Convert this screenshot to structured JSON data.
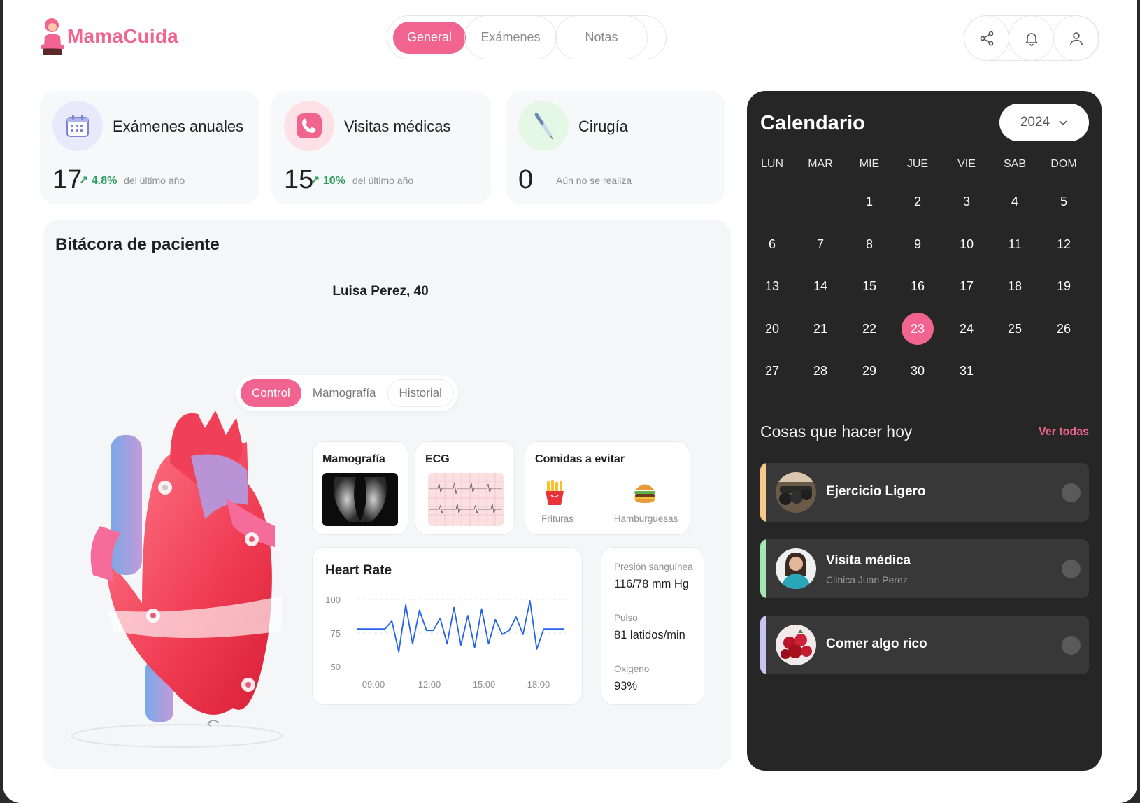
{
  "app": {
    "name": "MamaCuida"
  },
  "nav": {
    "tabs": [
      "General",
      "Exámenes",
      "Notas"
    ],
    "active": "General"
  },
  "header_actions": [
    "share-icon",
    "bell-icon",
    "user-icon"
  ],
  "stats": [
    {
      "title": "Exámenes anuales",
      "value": "17",
      "trend": "↗ 4.8%",
      "note": "del último año",
      "icon": "calendar-icon"
    },
    {
      "title": "Visitas médicas",
      "value": "15",
      "trend": "↗ 10%",
      "note": "del último año",
      "icon": "phone-icon"
    },
    {
      "title": "Cirugía",
      "value": "0",
      "trend": "",
      "note": "Aún no se realiza",
      "icon": "syringe-icon"
    }
  ],
  "bitacora": {
    "title": "Bitácora de paciente",
    "patient": "Luisa Perez, 40",
    "tabs": [
      "Control",
      "Mamografía",
      "Historial"
    ],
    "active_tab": "Control",
    "cards": {
      "mamografia": "Mamografía",
      "ecg": "ECG",
      "comidas": {
        "title": "Comidas a evitar",
        "items": [
          "Frituras",
          "Hamburguesas"
        ]
      }
    },
    "heart_rate": {
      "title": "Heart Rate",
      "y_ticks": [
        "100",
        "75",
        "50"
      ],
      "x_ticks": [
        "09:00",
        "12:00",
        "15:00",
        "18:00"
      ]
    },
    "vitals": [
      {
        "label": "Presión sanguínea",
        "value": "116/78 mm Hg"
      },
      {
        "label": "Pulso",
        "value": "81 latidos/min"
      },
      {
        "label": "Oxigeno",
        "value": "93%"
      }
    ]
  },
  "chart_data": {
    "type": "line",
    "title": "Heart Rate",
    "x_ticks": [
      "09:00",
      "12:00",
      "15:00",
      "18:00"
    ],
    "ylim": [
      50,
      100
    ],
    "series": [
      {
        "values": [
          78,
          78,
          78,
          78,
          78,
          84,
          61,
          96,
          67,
          92,
          77,
          77,
          86,
          67,
          94,
          66,
          88,
          64,
          93,
          67,
          85,
          74,
          77,
          87,
          74,
          99,
          63,
          78,
          78,
          78,
          78
        ]
      }
    ],
    "accent": "#2563eb"
  },
  "calendar": {
    "title": "Calendario",
    "year": "2024",
    "weekdays": [
      "LUN",
      "MAR",
      "MIE",
      "JUE",
      "VIE",
      "SAB",
      "DOM"
    ],
    "first_weekday_index": 2,
    "days_in_month": 31,
    "today": 23
  },
  "todo": {
    "title": "Cosas que hacer hoy",
    "see_all": "Ver todas",
    "items": [
      {
        "name": "Ejercicio Ligero",
        "sub": "",
        "accent": "#f7c98a",
        "icon": "dumbbell-photo"
      },
      {
        "name": "Visita médica",
        "sub": "Clinica Juan Perez",
        "accent": "#a8e4b4",
        "icon": "doctor-photo"
      },
      {
        "name": "Comer algo rico",
        "sub": "",
        "accent": "#c8c4f2",
        "icon": "berries-photo"
      }
    ]
  },
  "colors": {
    "brand": "#f0648f",
    "trend": "#2aa05a",
    "calendar_bg": "#262626"
  }
}
